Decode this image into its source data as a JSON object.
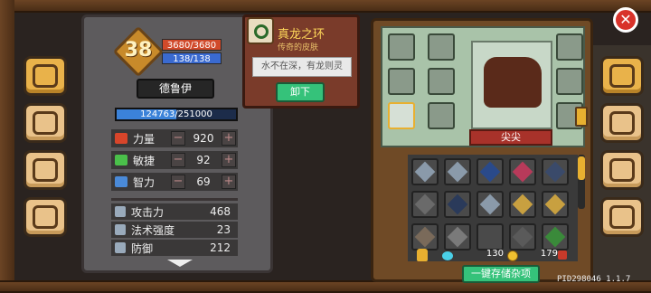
{
  "hero": {
    "level": "38",
    "hp": "3680/3680",
    "mp": "138/138",
    "class_name": "德鲁伊",
    "exp": "124763/251000",
    "exp_fraction": 0.497
  },
  "attributes": [
    {
      "label": "力量",
      "value": "920",
      "color": "#d8452a"
    },
    {
      "label": "敏捷",
      "value": "92",
      "color": "#4ac04a"
    },
    {
      "label": "智力",
      "value": "69",
      "color": "#4a8ad8"
    }
  ],
  "combat_stats": [
    {
      "label": "攻击力",
      "value": "468"
    },
    {
      "label": "法术强度",
      "value": "23"
    },
    {
      "label": "防御",
      "value": "212"
    }
  ],
  "tooltip": {
    "item_name": "真龙之环",
    "item_subtitle": "传奇的皮肤",
    "description": "水不在深，有龙则灵",
    "unequip_label": "卸下"
  },
  "character": {
    "pet_name": "尖尖"
  },
  "currency": {
    "gems": "130",
    "coins": "179"
  },
  "store_all_label": "一键存储杂项",
  "version": "PID298046 1.1.7",
  "close_label": "✕",
  "icons": {
    "side_left": [
      "book-icon",
      "map-scroll-icon",
      "pawprint-icon",
      "steering-wheel-icon"
    ],
    "side_right": [
      "helmet-icon",
      "weapons-icon",
      "compass-icon",
      "gear-icon"
    ]
  }
}
